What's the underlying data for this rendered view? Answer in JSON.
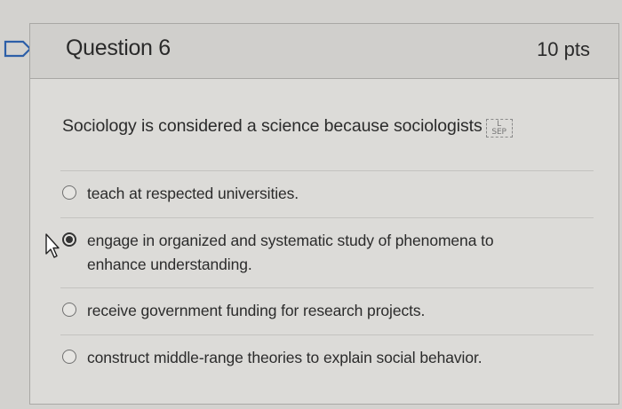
{
  "question": {
    "title": "Question 6",
    "points": "10 pts",
    "text": "Sociology is considered a science because sociologists",
    "sep_marker": "L SEP"
  },
  "answers": [
    {
      "label": "teach at respected universities.",
      "selected": false
    },
    {
      "label_line1": "engage in organized and systematic study of phenomena to",
      "label_line2": "enhance understanding.",
      "selected": true
    },
    {
      "label": "receive government funding for research projects.",
      "selected": false
    },
    {
      "label": "construct middle-range theories to explain social behavior.",
      "selected": false
    }
  ],
  "icons": {
    "flag": "flag-icon",
    "cursor": "mouse-cursor-icon"
  },
  "colors": {
    "background": "#d3d2cf",
    "card": "#dcdbd8",
    "header": "#d0cfcc",
    "flag": "#2d5fa8",
    "text": "#2b2b2b"
  }
}
